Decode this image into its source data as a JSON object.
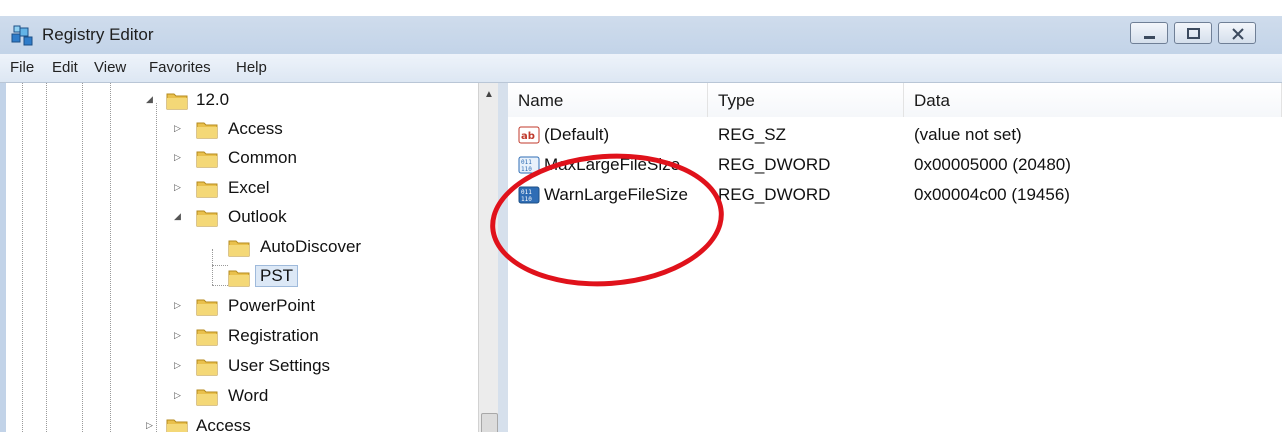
{
  "window": {
    "title": "Registry Editor"
  },
  "menu": [
    {
      "label": "File"
    },
    {
      "label": "Edit"
    },
    {
      "label": "View"
    },
    {
      "label": "Favorites"
    },
    {
      "label": "Help"
    }
  ],
  "tree": [
    {
      "label": "12.0",
      "state": "expanded"
    },
    {
      "label": "Access",
      "state": "collapsed"
    },
    {
      "label": "Common",
      "state": "collapsed"
    },
    {
      "label": "Excel",
      "state": "collapsed"
    },
    {
      "label": "Outlook",
      "state": "expanded"
    },
    {
      "label": "AutoDiscover",
      "state": "leaf"
    },
    {
      "label": "PST",
      "state": "selected"
    },
    {
      "label": "PowerPoint",
      "state": "collapsed"
    },
    {
      "label": "Registration",
      "state": "collapsed"
    },
    {
      "label": "User Settings",
      "state": "collapsed"
    },
    {
      "label": "Word",
      "state": "collapsed"
    },
    {
      "label": "Access",
      "state": "collapsed"
    }
  ],
  "columns": {
    "name": "Name",
    "type": "Type",
    "data": "Data"
  },
  "values": [
    {
      "name": "(Default)",
      "type": "REG_SZ",
      "data": "(value not set)",
      "icon": "string-value-icon"
    },
    {
      "name": "MaxLargeFileSize",
      "type": "REG_DWORD",
      "data": "0x00005000 (20480)",
      "icon": "dword-value-icon"
    },
    {
      "name": "WarnLargeFileSize",
      "type": "REG_DWORD",
      "data": "0x00004c00 (19456)",
      "icon": "dword-value-icon"
    }
  ],
  "annotation": {
    "color": "#e0121b",
    "shape": "red-oval"
  }
}
